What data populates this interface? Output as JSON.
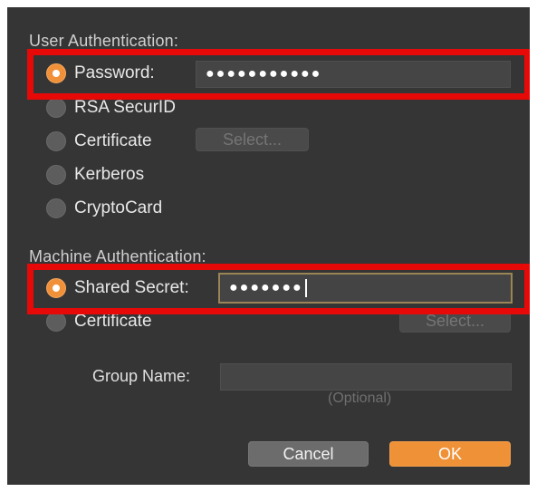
{
  "user_auth": {
    "label": "User Authentication:",
    "options": [
      {
        "label": "Password:",
        "selected": true
      },
      {
        "label": "RSA SecurID",
        "selected": false
      },
      {
        "label": "Certificate",
        "selected": false
      },
      {
        "label": "Kerberos",
        "selected": false
      },
      {
        "label": "CryptoCard",
        "selected": false
      }
    ],
    "password_value": "●●●●●●●●●●●",
    "select_button": "Select..."
  },
  "machine_auth": {
    "label": "Machine Authentication:",
    "options": [
      {
        "label": "Shared Secret:",
        "selected": true
      },
      {
        "label": "Certificate",
        "selected": false
      }
    ],
    "shared_secret_value": "●●●●●●●",
    "select_button": "Select..."
  },
  "group": {
    "label": "Group Name:",
    "value": "",
    "hint": "(Optional)"
  },
  "buttons": {
    "cancel": "Cancel",
    "ok": "OK"
  },
  "colors": {
    "accent": "#ef9136",
    "highlight": "#e70808",
    "background": "#353535"
  }
}
